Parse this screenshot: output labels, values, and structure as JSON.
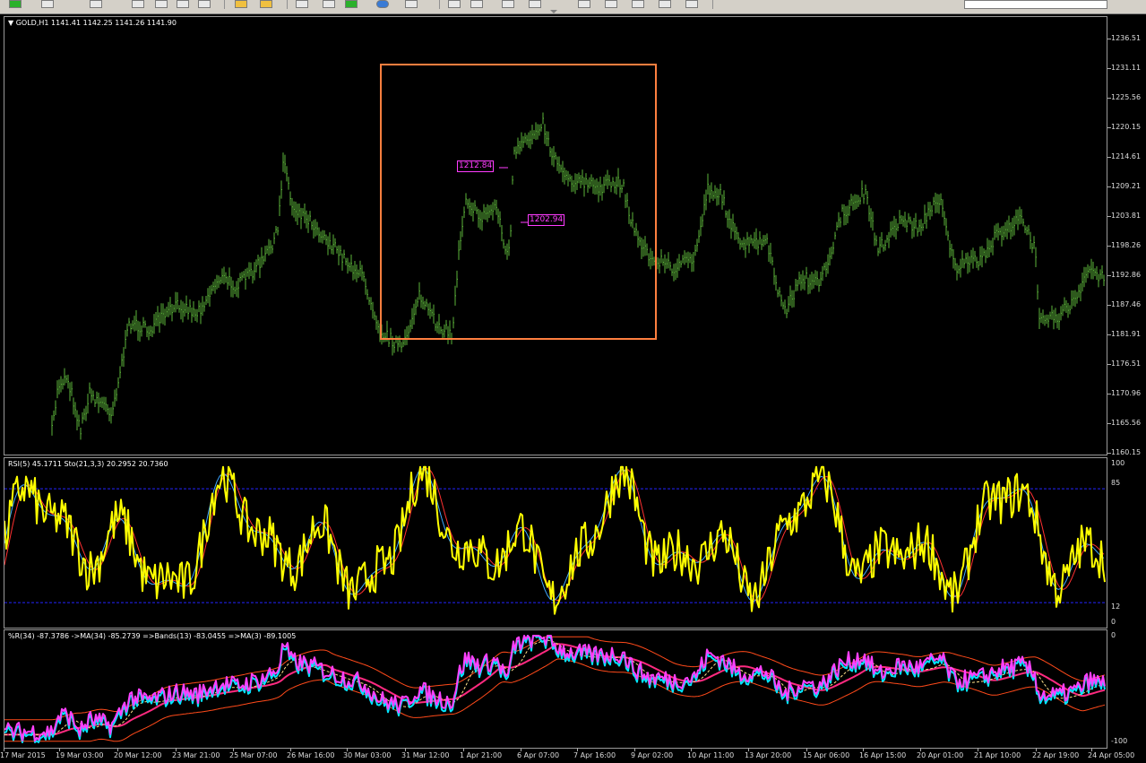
{
  "main_chart": {
    "title": "GOLD,H1  1141.41 1142.25 1141.26 1141.90",
    "price_labels": [
      "1236.51",
      "1231.11",
      "1225.56",
      "1220.15",
      "1214.61",
      "1209.21",
      "1203.81",
      "1198.26",
      "1192.86",
      "1187.46",
      "1181.91",
      "1176.51",
      "1170.96",
      "1165.56",
      "1160.15"
    ],
    "price_tag_1": "1212.84",
    "price_tag_2": "1202.94"
  },
  "rsi_pane": {
    "title": "RSI(5) 45.1711  Sto(21,3,3) 20.2952 20.7360",
    "levels": [
      "100",
      "85",
      "12",
      "0"
    ]
  },
  "wpr_pane": {
    "title": "%R(34) -87.3786  ->MA(34) -85.2739  =>Bands(13) -83.0455  =>MA(3) -89.1005",
    "levels": [
      "0",
      "-100"
    ]
  },
  "time_axis": [
    "17 Mar 2015",
    "19 Mar 03:00",
    "20 Mar 12:00",
    "23 Mar 21:00",
    "25 Mar 07:00",
    "26 Mar 16:00",
    "30 Mar 03:00",
    "31 Mar 12:00",
    "1 Apr 21:00",
    "6 Apr 07:00",
    "7 Apr 16:00",
    "9 Apr 02:00",
    "10 Apr 11:00",
    "13 Apr 20:00",
    "15 Apr 06:00",
    "16 Apr 15:00",
    "20 Apr 01:00",
    "21 Apr 10:00",
    "22 Apr 19:00",
    "24 Apr 05:00"
  ],
  "colors": {
    "candles": "#5cb33a",
    "rsi": "#ffff00",
    "stoch_main": "#3fa9ff",
    "stoch_signal": "#ff3030",
    "wpr": "#00e5ff",
    "wpr_ma": "#ff40ff",
    "bands_mid": "#ff2a80",
    "bands_edge": "#ff4a1a",
    "level_lines": "#2323ff",
    "highlight": "#ff7f3f",
    "price_tag": "#ff3cff"
  },
  "icons": [
    "new-order-icon",
    "chart-window-icon",
    "bar-chart-icon",
    "candle-chart-icon",
    "line-chart-icon",
    "zoom-in-icon",
    "zoom-out-icon",
    "autoscroll-icon",
    "add-indicator-icon",
    "period-icon",
    "templates-icon",
    "cursor-icon",
    "crosshair-icon",
    "trendline-icon",
    "text-icon"
  ]
}
